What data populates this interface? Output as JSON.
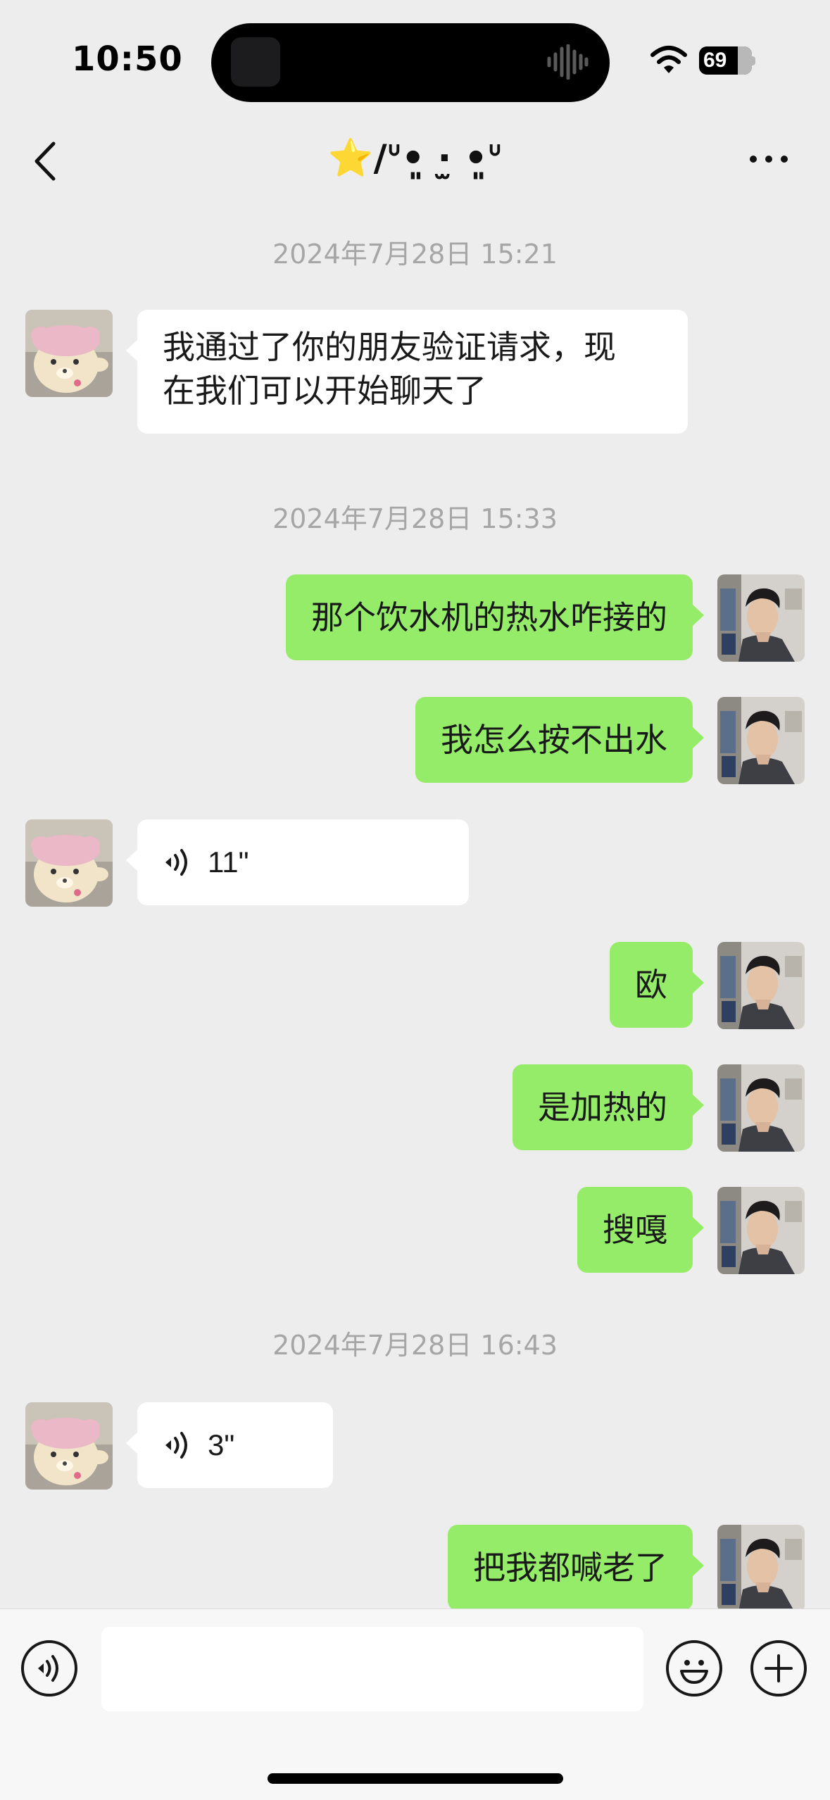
{
  "status_bar": {
    "time": "10:50",
    "battery": "69",
    "icons": [
      "wifi-icon",
      "battery-icon"
    ]
  },
  "nav": {
    "title": "⭐️/ᐡ•͈ ·̫ •͈ᐡ",
    "icons": [
      "chevron-left-icon",
      "more-icon"
    ]
  },
  "messages": {
    "ts1": "2024年7月28日 15:21",
    "m1_line1": "我通过了你的朋友验证请求，现",
    "m1_line2": "在我们可以开始聊天了",
    "ts2": "2024年7月28日 15:33",
    "m2": "那个饮水机的热水咋接的",
    "m3": "我怎么按不出水",
    "m4_voice": "11\"",
    "m5": "欧",
    "m6": "是加热的",
    "m7": "搜嘎",
    "ts3": "2024年7月28日 16:43",
    "m8_voice": "3\"",
    "m9": "把我都喊老了"
  },
  "input": {
    "value": "",
    "icons": [
      "voice-mode-icon",
      "emoji-icon",
      "plus-icon"
    ]
  },
  "colors": {
    "background": "#ededed",
    "sent_bubble": "#95ec69",
    "received_bubble": "#ffffff",
    "timestamp": "#a6a6a6"
  }
}
